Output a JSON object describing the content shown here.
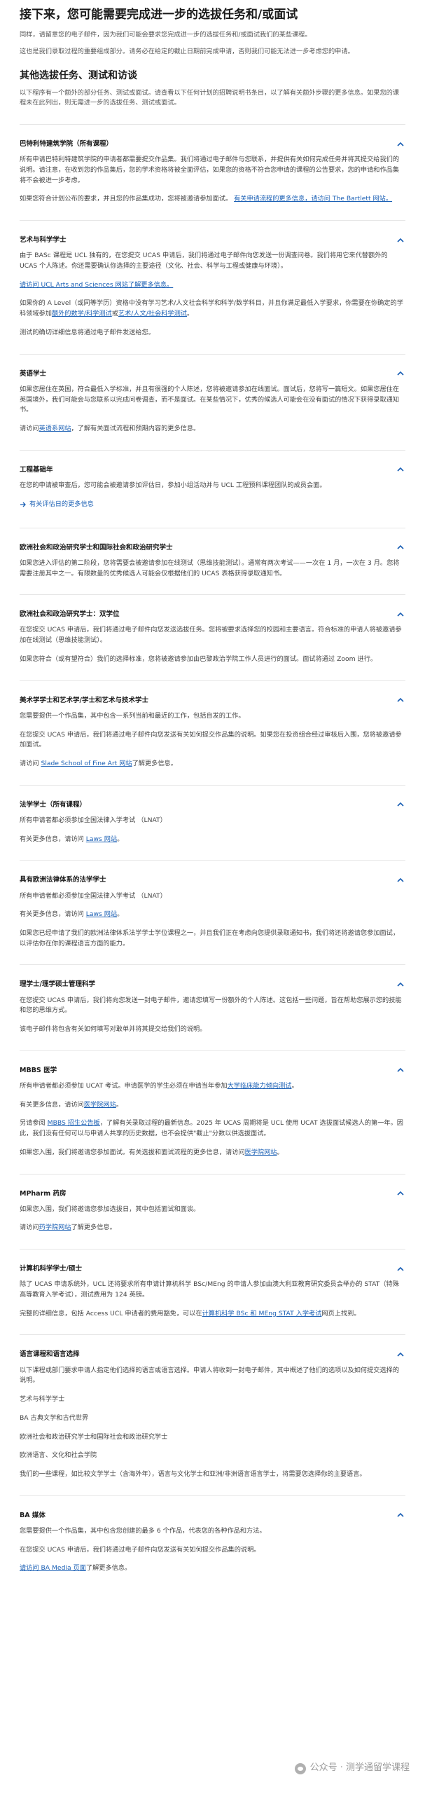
{
  "header": {
    "title": "接下来，您可能需要完成进一步的选拔任务和/或面试",
    "intro1": "同样，请留意您的电子邮件，因为我们可能会要求您完成进一步的选拔任务和/或面试我们的某些课程。",
    "intro2": "这也是我们录取过程的重要组成部分。请务必在给定的截止日期前完成申请，否则我们可能无法进一步考虑您的申请。"
  },
  "section": {
    "title": "其他选拔任务、测试和访谈",
    "intro": "以下程序有一个额外的部分任务、测试或面试。请查看以下任何计划的招聘说明书条目，以了解有关额外步骤的更多信息。如果您的课程未在此列出，则无需进一步的选拔任务、测试或面试。"
  },
  "items": {
    "bartlett": {
      "title": "巴特利特建筑学院（所有课程）",
      "p1": "所有申请巴特利特建筑学院的申请者都需要提交作品集。我们将通过电子邮件与您联系，并提供有关如何完成任务并将其提交给我们的说明。请注意，在收到您的作品集后，您的学术资格将被全面评估，如果您的资格不符合您申请的课程的公告要求，您的申请和作品集将不会被进一步考虑。",
      "p2a": "如果您符合计划公布的要求，并且您的作品集成功，您将被邀请参加面试。",
      "p2link": "有关申请流程的更多信息，请访问 The Bartlett 网站。"
    },
    "arts": {
      "title": "艺术与科学学士",
      "p1": "由于 BASc 课程是 UCL 独有的，在您提交 UCAS 申请后，我们将通过电子邮件向您发送一份调查问卷。我们将用它来代替额外的 UCAS 个人陈述。你还需要确认你选择的主要途径（文化、社会、科学与工程或健康与环境）。",
      "link1": "请访问 UCL Arts and Sciences 网站了解更多信息。",
      "p2a": "如果你的 A Level（或同等学历）资格中没有学习艺术/人文社会科学和科学/数学科目，并且你满足最低入学要求，你需要在你确定的学科领域参加",
      "p2link1": "额外的数学/科学测试",
      "p2mid": "或",
      "p2link2": "艺术/人文/社会科学测试",
      "p2end": "。",
      "p3": "测试的确切详细信息将通过电子邮件发送给您。"
    },
    "english": {
      "title": "英语学士",
      "p1": "如果您居住在英国，符合最低入学标准，并且有很强的个人陈述，您将被邀请参加在线面试。面试后，您将写一篇短文。如果您居住在英国境外，我们可能会与您联系以完成问卷调查，而不是面试。在某些情况下，优秀的候选人可能会在没有面试的情况下获得录取通知书。",
      "p2a": "请访问",
      "p2link": "英语系网站",
      "p2b": "，了解有关面试流程和预期内容的更多信息。"
    },
    "engineering": {
      "title": "工程基础年",
      "p1": "在您的申请被审查后，您可能会被邀请参加评估日，参加小组活动并与 UCL 工程预科课程团队的成员会面。",
      "link": "有关评估日的更多信息"
    },
    "euro_law": {
      "title": "欧洲社会和政治研究学士和国际社会和政治研究学士",
      "p1": "如果您进入评估的第二阶段，您将需要会被邀请参加在线测试（思维技能测试）。通常有两次考试——一次在 1 月，一次在 3 月。您将需要注册其中之一。有限数量的优秀候选人可能会仅根据他们的 UCAS 表格获得录取通知书。"
    },
    "euro_dual": {
      "title": "欧洲社会和政治研究学士：双学位",
      "p1": "在您提交 UCAS 申请后，我们将通过电子邮件向您发送选拔任务。您将被要求选择您的校园和主要语言。符合标准的申请人将被邀请参加在线测试（思维技能测试）。",
      "p2": "如果您符合（或有望符合）我们的选择标准，您将被邀请参加由巴黎政治学院工作人员进行的面试。面试将通过 Zoom 进行。"
    },
    "fine_art": {
      "title": "美术学学士和艺术学/学士和艺术与技术学士",
      "p1": "您需要提供一个作品集，其中包含一系列当前和最近的工作，包括自发的工作。",
      "p2": "在您提交 UCAS 申请后，我们将通过电子邮件向您发送有关如何提交作品集的说明。如果您在投资组合经过审核后入围，您将被邀请参加面试。",
      "p3a": "请访问",
      "p3link": "Slade School of Fine Art 网站",
      "p3b": "了解更多信息。"
    },
    "law_all": {
      "title": "法学学士（所有课程）",
      "p1": "所有申请者都必须参加全国法律入学考试 （LNAT）",
      "p2a": "有关更多信息，请访问",
      "p2link": "Laws 网站",
      "p2b": "。"
    },
    "law_euro": {
      "title": "具有欧洲法律体系的法学学士",
      "p1": "所有申请者都必须参加全国法律入学考试 （LNAT）",
      "p2a": "有关更多信息，请访问",
      "p2link": "Laws 网站",
      "p2b": "。",
      "p3": "如果您已经申请了我们的欧洲法律体系法学学士学位课程之一，并且我们正在考虑向您提供录取通知书，我们将还将邀请您参加面试，以评估你在你的课程语言方面的能力。"
    },
    "science_mgmt": {
      "title": "理学士/理学硕士管理科学",
      "p1": "在您提交 UCAS 申请后，我们将向您发送一封电子邮件，邀请您填写一份额外的个人陈述。这包括一些问题，旨在帮助您展示您的技能和您的思维方式。",
      "p2": "该电子邮件将包含有关如何填写对敢单并将其提交给我们的说明。"
    },
    "mbbs": {
      "title": "MBBS 医学",
      "p1a": "所有申请者都必须参加 UCAT 考试。申请医学的学生必须在申请当年参加",
      "p1link": "大学临床能力倾向测试",
      "p1b": "。",
      "p2a": "有关更多信息，请访问",
      "p2link": "医学院网站",
      "p2b": "。",
      "p3a": "另请参阅",
      "p3link": "MBBS 招生公告板",
      "p3b": "，了解有关录取过程的最新信息。2025 年 UCAS 周期将是 UCL 使用 UCAT 选拔面试候选人的第一年。因此，我们没有任何可以与申请人共享的历史数据，也不会提供\"截止\"分数以供选拔面试。",
      "p4a": "如果您入围，我们将邀请您参加面试。有关选拔和面试流程的更多信息，请访问",
      "p4link": "医学院网站",
      "p4b": "。"
    },
    "mpharm": {
      "title": "MPharm 药房",
      "p1": "如果您入围，我们将邀请您参加选拔日，其中包括面试和面谈。",
      "p2a": "请访问",
      "p2link": "药学院网站",
      "p2b": "了解更多信息。"
    },
    "cs": {
      "title": "计算机科学学士/硕士",
      "p1": "除了 UCAS 申请系统外，UCL 还将要求所有申请计算机科学 BSc/MEng 的申请人参加由澳大利亚教育研究委员会举办的 STAT（特殊高等教育入学考试），测试费用为 124 英镑。",
      "p2a": "完整的详细信息，包括 Access UCL 申请者的费用豁免，可以在",
      "p2link": "计算机科学 BSc 和 MEng STAT 入学考试",
      "p2b": "网页上找到。"
    },
    "languages": {
      "title": "语言课程和语言选择",
      "p1": "以下课程或部门要求申请人指定他们选择的语言或语言选择。申请人将收到一封电子邮件，其中概述了他们的选项以及如何提交选择的说明。",
      "l1": "艺术与科学学士",
      "l2": "BA 古典文学和古代世界",
      "l3": "欧洲社会和政治研究学士和国际社会和政治研究学士",
      "l4": "欧洲语言、文化和社会学院",
      "p2": "我们的一些课程，如比较文学学士（含海外年），语言与文化学士和亚洲/非洲语言语言学士，将需要您选择你的主要语言。"
    },
    "media": {
      "title": "BA 媒体",
      "p1": "您需要提供一个作品集，其中包含您创建的最多 6 个作品，代表您的各种作品和方法。",
      "p2": "在您提交 UCAS 申请后，我们将通过电子邮件向您发送有关如何提交作品集的说明。",
      "p3link": "请访问 BA Media 页面",
      "p3b": "了解更多信息。"
    }
  },
  "watermark": {
    "text": "公众号 · 测学通留学课程"
  },
  "colors": {
    "link": "#1a5fb4",
    "text": "#333333",
    "divider": "#e6e6e6"
  }
}
